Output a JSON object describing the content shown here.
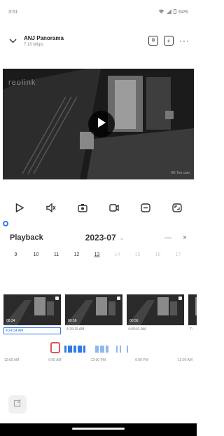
{
  "status_bar": {
    "time": "3:51",
    "battery": "64%"
  },
  "header": {
    "camera_name": "ANJ Panorama",
    "camera_subtitle": "7:10 Mbps"
  },
  "video": {
    "logo": "reolink",
    "timestamp": "HE Ton cam"
  },
  "toolbar": {
    "tools": [
      {
        "name": "play-icon"
      },
      {
        "name": "speaker-icon"
      },
      {
        "name": "snapshot-icon"
      },
      {
        "name": "record-icon"
      },
      {
        "name": "clip-icon"
      },
      {
        "name": "fullscreen-icon"
      }
    ]
  },
  "playback": {
    "title": "Playback",
    "month": "2023-07",
    "minimize": "—",
    "close": "×",
    "days": [
      {
        "label": "9",
        "state": "normal"
      },
      {
        "label": "10",
        "state": "normal"
      },
      {
        "label": "11",
        "state": "normal"
      },
      {
        "label": "12",
        "state": "normal"
      },
      {
        "label": "13",
        "state": "selected"
      },
      {
        "label": "14",
        "state": "faded"
      },
      {
        "label": "15",
        "state": "faded"
      },
      {
        "label": "16",
        "state": "faded"
      },
      {
        "label": "17",
        "state": "faded"
      }
    ],
    "clips": [
      {
        "duration": "00:34",
        "time": "4:24:34 AM",
        "active": true
      },
      {
        "duration": "00:56",
        "time": "4:29:19 AM",
        "active": false
      },
      {
        "duration": "00:56",
        "time": "4:40:41 AM",
        "active": false
      },
      {
        "duration": "",
        "time": "7:",
        "active": false
      }
    ],
    "timeline_labels": [
      "12:00 AM",
      "6:00 AM",
      "12:00 PM",
      "6:00 PM",
      "12:00 AM"
    ]
  }
}
